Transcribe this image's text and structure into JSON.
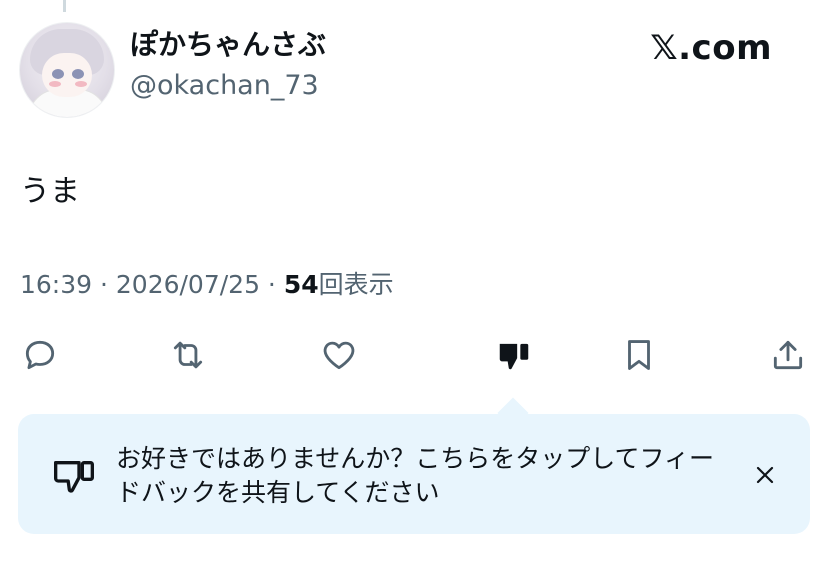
{
  "tweet": {
    "author": {
      "display_name": "ぽかちゃんさぶ",
      "handle": "@okachan_73"
    },
    "brand": "𝕏.com",
    "text": "うま",
    "meta": {
      "time": "16:39",
      "separator": " · ",
      "date": "2026/07/25",
      "views_count": "54",
      "views_label": "回表示"
    }
  },
  "actions": [
    {
      "icon": "reply-icon"
    },
    {
      "icon": "retweet-icon"
    },
    {
      "icon": "like-icon"
    },
    {
      "icon": "dislike-icon"
    },
    {
      "icon": "bookmark-icon"
    },
    {
      "icon": "share-icon"
    }
  ],
  "feedback_notice": {
    "text": "お好きではありませんか？こちらをタップしてフィードバックを共有してください",
    "icon": "thumbs-down-icon",
    "close_icon": "close-icon"
  },
  "colors": {
    "text": "#0f1419",
    "secondary": "#536471",
    "notice_bg": "#e8f5fd"
  }
}
